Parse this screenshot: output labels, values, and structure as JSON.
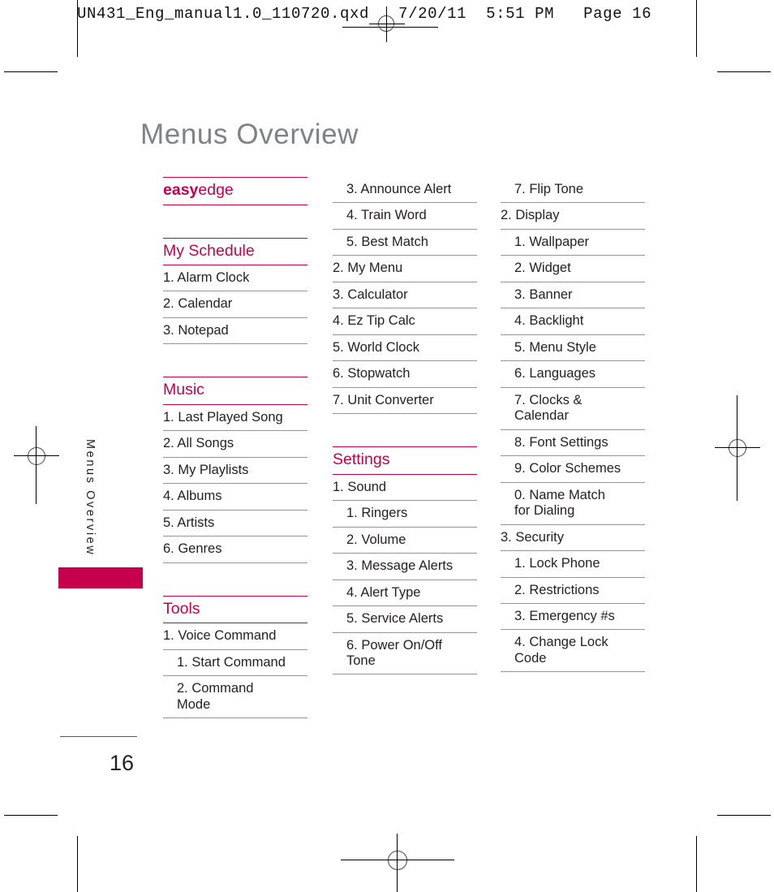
{
  "slug": {
    "text": "UN431_Eng_manual1.0_110720.qxd   7/20/11  5:51 PM   Page 16"
  },
  "page": {
    "title": "Menus Overview",
    "side_tab_label": "Menus Overview",
    "folio": "16",
    "accent_color": "#c6004c",
    "title_color": "#808285"
  },
  "columns": [
    {
      "id": "column-1",
      "blocks": [
        {
          "type": "heading",
          "kind": "split",
          "bold_part": "easy",
          "light_part": "edge",
          "items": []
        },
        {
          "type": "gap"
        },
        {
          "type": "heading",
          "kind": "plain",
          "label": "My Schedule",
          "items": [
            {
              "level": 1,
              "text": "1. Alarm Clock"
            },
            {
              "level": 1,
              "text": "2. Calendar"
            },
            {
              "level": 1,
              "text": "3. Notepad"
            }
          ]
        },
        {
          "type": "gap"
        },
        {
          "type": "heading",
          "kind": "plain",
          "label": "Music",
          "items": [
            {
              "level": 1,
              "text": "1. Last Played Song"
            },
            {
              "level": 1,
              "text": "2. All Songs"
            },
            {
              "level": 1,
              "text": "3. My Playlists"
            },
            {
              "level": 1,
              "text": "4. Albums"
            },
            {
              "level": 1,
              "text": "5. Artists"
            },
            {
              "level": 1,
              "text": "6. Genres"
            }
          ]
        },
        {
          "type": "gap"
        },
        {
          "type": "heading",
          "kind": "plain",
          "label": "Tools",
          "items": [
            {
              "level": 1,
              "text": "1. Voice Command"
            },
            {
              "level": 2,
              "text": "1. Start Command"
            },
            {
              "level": 2,
              "text": "2. Command\nMode"
            }
          ]
        }
      ]
    },
    {
      "id": "column-2",
      "blocks": [
        {
          "type": "list",
          "items": [
            {
              "level": 2,
              "text": "3. Announce Alert"
            },
            {
              "level": 2,
              "text": "4. Train Word"
            },
            {
              "level": 2,
              "text": "5. Best Match"
            },
            {
              "level": 1,
              "text": "2. My Menu"
            },
            {
              "level": 1,
              "text": "3. Calculator"
            },
            {
              "level": 1,
              "text": "4. Ez Tip Calc"
            },
            {
              "level": 1,
              "text": "5. World Clock"
            },
            {
              "level": 1,
              "text": "6. Stopwatch"
            },
            {
              "level": 1,
              "text": "7. Unit Converter"
            }
          ]
        },
        {
          "type": "gap"
        },
        {
          "type": "heading",
          "kind": "plain",
          "label": "Settings",
          "items": [
            {
              "level": 1,
              "text": "1. Sound"
            },
            {
              "level": 2,
              "text": "1. Ringers"
            },
            {
              "level": 2,
              "text": "2. Volume"
            },
            {
              "level": 2,
              "text": "3. Message Alerts"
            },
            {
              "level": 2,
              "text": "4. Alert Type"
            },
            {
              "level": 2,
              "text": "5. Service Alerts"
            },
            {
              "level": 2,
              "text": "6. Power On/Off\nTone"
            }
          ]
        }
      ]
    },
    {
      "id": "column-3",
      "blocks": [
        {
          "type": "list",
          "items": [
            {
              "level": 2,
              "text": "7. Flip Tone"
            },
            {
              "level": 1,
              "text": "2. Display"
            },
            {
              "level": 2,
              "text": "1. Wallpaper"
            },
            {
              "level": 2,
              "text": "2. Widget"
            },
            {
              "level": 2,
              "text": "3. Banner"
            },
            {
              "level": 2,
              "text": "4. Backlight"
            },
            {
              "level": 2,
              "text": "5. Menu Style"
            },
            {
              "level": 2,
              "text": "6. Languages"
            },
            {
              "level": 2,
              "text": "7. Clocks &\nCalendar"
            },
            {
              "level": 2,
              "text": "8. Font Settings"
            },
            {
              "level": 2,
              "text": "9. Color Schemes"
            },
            {
              "level": 2,
              "text": "0. Name Match\nfor Dialing"
            },
            {
              "level": 1,
              "text": "3. Security"
            },
            {
              "level": 2,
              "text": "1. Lock Phone"
            },
            {
              "level": 2,
              "text": "2. Restrictions"
            },
            {
              "level": 2,
              "text": "3. Emergency #s"
            },
            {
              "level": 2,
              "text": "4. Change Lock\nCode"
            }
          ]
        }
      ]
    }
  ]
}
